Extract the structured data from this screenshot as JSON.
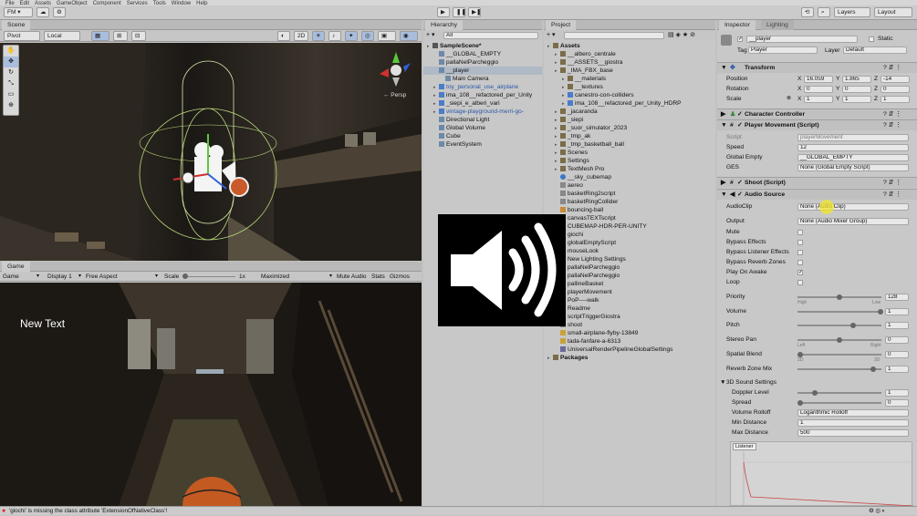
{
  "menu": [
    "File",
    "Edit",
    "Assets",
    "GameObject",
    "Component",
    "Services",
    "Tools",
    "Window",
    "Help"
  ],
  "toolbar": {
    "account": "FM ▾",
    "layers": "Layers",
    "layout": "Layout"
  },
  "scene": {
    "tab": "Scene",
    "pivot": "Pivot",
    "local": "Local",
    "mode2d": "2D",
    "persp": "← Persp"
  },
  "hierarchy": {
    "tab": "Hierarchy",
    "search_placeholder": "All",
    "items": [
      {
        "label": "SampleScene*",
        "depth": 0,
        "icon": "scene-icon",
        "bold": true
      },
      {
        "label": "__GLOBAL_EMPTY",
        "depth": 1,
        "icon": "cube-icon"
      },
      {
        "label": "pallaNelParcheggio",
        "depth": 1,
        "icon": "cube-icon"
      },
      {
        "label": "__player",
        "depth": 1,
        "icon": "cube-icon",
        "selected": true
      },
      {
        "label": "Main Camera",
        "depth": 2,
        "icon": "cube-icon"
      },
      {
        "label": "toy_personal_use_airplane",
        "depth": 1,
        "icon": "prefab-icon",
        "blue": true
      },
      {
        "label": "ima_108__refactored_per_Unity",
        "depth": 1,
        "icon": "prefab-icon"
      },
      {
        "label": "_siepi_e_alberi_vari",
        "depth": 1,
        "icon": "prefab-icon"
      },
      {
        "label": "vintage-playground-merri-go-",
        "depth": 1,
        "icon": "prefab-icon",
        "blue": true
      },
      {
        "label": "Directional Light",
        "depth": 1,
        "icon": "cube-icon"
      },
      {
        "label": "Global Volume",
        "depth": 1,
        "icon": "cube-icon"
      },
      {
        "label": "Cube",
        "depth": 1,
        "icon": "cube-icon"
      },
      {
        "label": "EventSystem",
        "depth": 1,
        "icon": "cube-icon"
      }
    ]
  },
  "project": {
    "tab": "Project",
    "items": [
      {
        "label": "Assets",
        "depth": 0,
        "icon": "folder-icon",
        "bold": true
      },
      {
        "label": "__albero_centrale",
        "depth": 1,
        "icon": "folder-icon"
      },
      {
        "label": "__ASSETS__giostra",
        "depth": 1,
        "icon": "folder-icon"
      },
      {
        "label": "_IMA_FBX_base",
        "depth": 1,
        "icon": "folder-icon"
      },
      {
        "label": "__materials",
        "depth": 2,
        "icon": "folder-icon"
      },
      {
        "label": "__textures",
        "depth": 2,
        "icon": "folder-icon"
      },
      {
        "label": "canestro-con-colliders",
        "depth": 2,
        "icon": "prefab-icon"
      },
      {
        "label": "ima_108__refactored_per_Unity_HDRP",
        "depth": 2,
        "icon": "prefab-icon"
      },
      {
        "label": "_jacaranda",
        "depth": 1,
        "icon": "folder-icon"
      },
      {
        "label": "_siepi",
        "depth": 1,
        "icon": "folder-icon"
      },
      {
        "label": "_suor_simulator_2023",
        "depth": 1,
        "icon": "folder-icon"
      },
      {
        "label": "_tmp_ak",
        "depth": 1,
        "icon": "folder-icon"
      },
      {
        "label": "_tmp_basketball_ball",
        "depth": 1,
        "icon": "folder-icon"
      },
      {
        "label": "Scenes",
        "depth": 1,
        "icon": "folder-icon"
      },
      {
        "label": "Settings",
        "depth": 1,
        "icon": "folder-icon"
      },
      {
        "label": "TextMesh Pro",
        "depth": 1,
        "icon": "folder-icon"
      },
      {
        "label": "__sky_cubemap",
        "depth": 1,
        "icon": "sphere-icon"
      },
      {
        "label": "aereo",
        "depth": 1,
        "icon": "script-icon"
      },
      {
        "label": "basketRing2script",
        "depth": 1,
        "icon": "script-icon"
      },
      {
        "label": "basketRingCollider",
        "depth": 1,
        "icon": "script-icon"
      },
      {
        "label": "bouncing-ball",
        "depth": 1,
        "icon": "material-icon"
      },
      {
        "label": "canvasTEXTscript",
        "depth": 1,
        "icon": "script-icon"
      },
      {
        "label": "CUBEMAP-HDR-PER-UNITY",
        "depth": 1,
        "icon": "image-icon"
      },
      {
        "label": "giochi",
        "depth": 1,
        "icon": "script-icon"
      },
      {
        "label": "globalEmptyScript",
        "depth": 1,
        "icon": "script-icon"
      },
      {
        "label": "mouseLook",
        "depth": 1,
        "icon": "script-icon"
      },
      {
        "label": "New Lighting Settings",
        "depth": 1,
        "icon": "settings-icon"
      },
      {
        "label": "pallaNelParcheggio",
        "depth": 1,
        "icon": "script-icon"
      },
      {
        "label": "pallaNelParcheggio",
        "depth": 1,
        "icon": "script-icon"
      },
      {
        "label": "pallineBasket",
        "depth": 1,
        "icon": "script-icon"
      },
      {
        "label": "playerMovement",
        "depth": 1,
        "icon": "script-icon"
      },
      {
        "label": "PoP----walk",
        "depth": 1,
        "icon": "script-icon"
      },
      {
        "label": "Readme",
        "depth": 1,
        "icon": "readme-icon"
      },
      {
        "label": "scriptTriggerGiostra",
        "depth": 1,
        "icon": "script-icon"
      },
      {
        "label": "shoot",
        "depth": 1,
        "icon": "script-icon"
      },
      {
        "label": "small-airplane-flyby-13849",
        "depth": 1,
        "icon": "audio-icon"
      },
      {
        "label": "tada-fanfare-a-6313",
        "depth": 1,
        "icon": "audio-icon"
      },
      {
        "label": "UniversalRenderPipelineGlobalSettings",
        "depth": 1,
        "icon": "settings-icon"
      },
      {
        "label": "Packages",
        "depth": 0,
        "icon": "folder-icon",
        "bold": true
      }
    ]
  },
  "game": {
    "tab": "Game",
    "display_mode": "Game",
    "display": "Display 1",
    "aspect": "Free Aspect",
    "scale_label": "Scale",
    "scale_value": "1x",
    "maximized": "Maximized",
    "mute": "Mute Audio",
    "stats": "Stats",
    "gizmos": "Gizmos",
    "overlay_text": "New Text"
  },
  "inspector": {
    "tab": "Inspector",
    "tab2": "Lighting",
    "object_name": "__player",
    "static_label": "Static",
    "tag_label": "Tag",
    "tag_value": "Player",
    "layer_label": "Layer",
    "layer_value": "Default",
    "transform": {
      "title": "Transform",
      "position_label": "Position",
      "rotation_label": "Rotation",
      "scale_label": "Scale",
      "position": {
        "x": "16.059",
        "y": "1.865",
        "z": "-14"
      },
      "rotation": {
        "x": "0",
        "y": "0",
        "z": "0"
      },
      "scale": {
        "x": "1",
        "y": "1",
        "z": "1"
      }
    },
    "char_controller": "Character Controller",
    "player_movement": {
      "title": "Player Movement (Script)",
      "script_label": "Script",
      "script_value": "playerMovement",
      "speed_label": "Speed",
      "speed_value": "12",
      "global_label": "Global Empty",
      "global_value": "__GLOBAL_EMPTY",
      "ges_label": "GES",
      "ges_value": "None (Global Empty Script)"
    },
    "shoot": "Shoot (Script)",
    "audio": {
      "title": "Audio Source",
      "clip_label": "AudioClip",
      "clip_value": "None (Audio Clip)",
      "output_label": "Output",
      "output_value": "None (Audio Mixer Group)",
      "mute_label": "Mute",
      "bypass_effects_label": "Bypass Effects",
      "bypass_listener_label": "Bypass Listener Effects",
      "bypass_reverb_label": "Bypass Reverb Zones",
      "play_on_awake_label": "Play On Awake",
      "loop_label": "Loop",
      "priority_label": "Priority",
      "priority_value": "128",
      "priority_high": "High",
      "priority_low": "Low",
      "volume_label": "Volume",
      "volume_value": "1",
      "pitch_label": "Pitch",
      "pitch_value": "1",
      "stereo_label": "Stereo Pan",
      "stereo_value": "0",
      "stereo_left": "Left",
      "stereo_right": "Right",
      "spatial_label": "Spatial Blend",
      "spatial_value": "0",
      "spatial_2d": "2D",
      "spatial_3d": "3D",
      "reverb_label": "Reverb Zone Mix",
      "reverb_value": "1",
      "sound3d_label": "3D Sound Settings",
      "doppler_label": "Doppler Level",
      "doppler_value": "1",
      "spread_label": "Spread",
      "spread_value": "0",
      "rolloff_label": "Volume Rolloff",
      "rolloff_value": "Logarithmic Rolloff",
      "min_dist_label": "Min Distance",
      "min_dist_value": "1",
      "max_dist_label": "Max Distance",
      "max_dist_value": "500",
      "listener_label": "Listener"
    }
  },
  "status": "'giochi' is missing the class attribute 'ExtensionOfNativeClass'!"
}
